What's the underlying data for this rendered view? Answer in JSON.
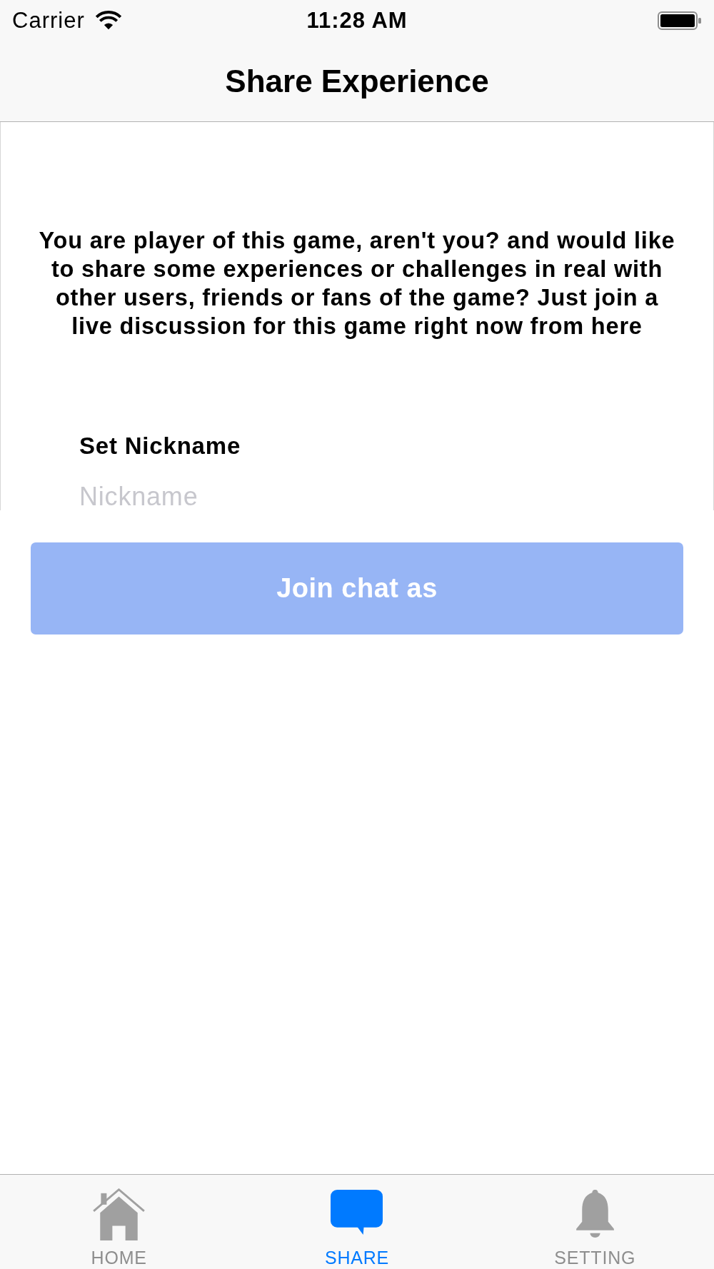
{
  "status_bar": {
    "carrier": "Carrier",
    "time": "11:28 AM"
  },
  "nav_bar": {
    "title": "Share Experience"
  },
  "intro": {
    "text": "You are player of this game, aren't you? and would like to share some experiences or challenges in real with other users, friends or fans of the game? Just join a live discussion for this game right now from here"
  },
  "nickname": {
    "label": "Set Nickname",
    "placeholder": "Nickname"
  },
  "join_button": {
    "label": "Join chat as",
    "disabled": true
  },
  "tab_bar": {
    "tabs": [
      {
        "kind": "home",
        "label": "HOME",
        "selected": false
      },
      {
        "kind": "chat",
        "label": "SHARE",
        "selected": true
      },
      {
        "kind": "bell",
        "label": "SETTING",
        "selected": false
      }
    ]
  }
}
